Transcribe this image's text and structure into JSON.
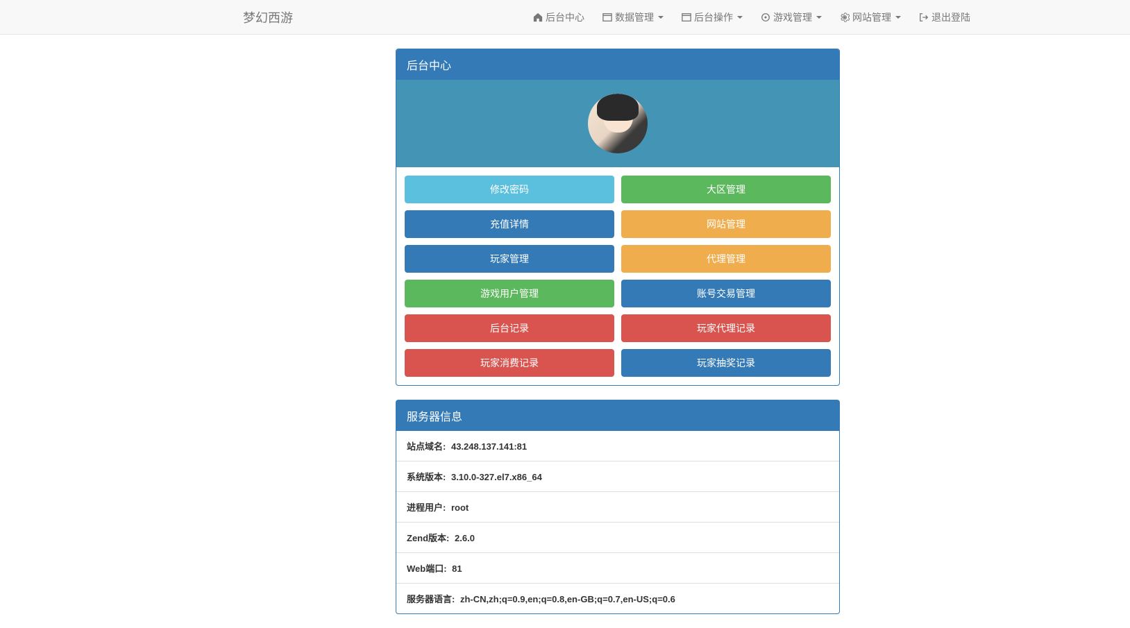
{
  "brand": "梦幻西游",
  "nav": {
    "home": "后台中心",
    "data": "数据管理",
    "backend": "后台操作",
    "game": "游戏管理",
    "site": "网站管理",
    "logout": "退出登陆"
  },
  "panel": {
    "title": "后台中心"
  },
  "buttons": {
    "modify_password": "修改密码",
    "zone_manage": "大区管理",
    "recharge_detail": "充值详情",
    "site_manage": "网站管理",
    "player_manage": "玩家管理",
    "agent_manage": "代理管理",
    "game_user_manage": "游戏用户管理",
    "account_trade_manage": "账号交易管理",
    "backend_log": "后台记录",
    "player_agent_log": "玩家代理记录",
    "player_consume_log": "玩家消费记录",
    "player_lottery_log": "玩家抽奖记录"
  },
  "server": {
    "title": "服务器信息",
    "items": [
      {
        "label": "站点域名:",
        "value": "43.248.137.141:81"
      },
      {
        "label": "系统版本:",
        "value": "3.10.0-327.el7.x86_64"
      },
      {
        "label": "进程用户:",
        "value": "root"
      },
      {
        "label": "Zend版本:",
        "value": "2.6.0"
      },
      {
        "label": "Web端口:",
        "value": "81"
      },
      {
        "label": "服务器语言:",
        "value": "zh-CN,zh;q=0.9,en;q=0.8,en-GB;q=0.7,en-US;q=0.6"
      }
    ]
  }
}
